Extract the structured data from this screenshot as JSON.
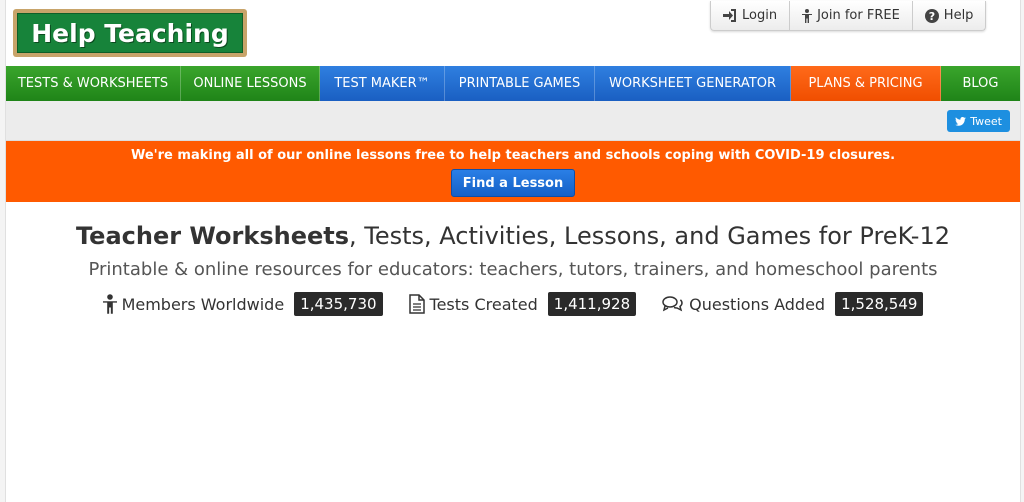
{
  "header": {
    "logo_text": "Help Teaching",
    "user_links": [
      {
        "label": "Login",
        "icon": "login-icon"
      },
      {
        "label": "Join for FREE",
        "icon": "person-icon"
      },
      {
        "label": "Help",
        "icon": "help-icon"
      }
    ]
  },
  "nav": {
    "items": [
      {
        "label": "TESTS & WORKSHEETS",
        "color": "green"
      },
      {
        "label": "ONLINE LESSONS",
        "color": "green"
      },
      {
        "label": "TEST MAKER™",
        "color": "blue"
      },
      {
        "label": "PRINTABLE GAMES",
        "color": "blue"
      },
      {
        "label": "WORKSHEET GENERATOR",
        "color": "blue"
      },
      {
        "label": "PLANS & PRICING",
        "color": "orange"
      },
      {
        "label": "BLOG",
        "color": "green"
      }
    ]
  },
  "tweet": {
    "label": "Tweet",
    "icon": "twitter-bird-icon"
  },
  "banner": {
    "text": "We're making all of our online lessons free to help teachers and schools coping with COVID-19 closures.",
    "button_label": "Find a Lesson"
  },
  "hero": {
    "title_bold": "Teacher Worksheets",
    "title_rest": ", Tests, Activities, Lessons, and Games for PreK-12",
    "subtitle": "Printable & online resources for educators: teachers, tutors, trainers, and homeschool parents",
    "stats": [
      {
        "label": "Members Worldwide",
        "count": "1,435,730",
        "icon": "person-icon"
      },
      {
        "label": "Tests Created",
        "count": "1,411,928",
        "icon": "document-icon"
      },
      {
        "label": "Questions Added",
        "count": "1,528,549",
        "icon": "comments-icon"
      }
    ]
  },
  "colors": {
    "green": "#1f8418",
    "blue": "#1a5fc2",
    "orange": "#ff5a00"
  }
}
